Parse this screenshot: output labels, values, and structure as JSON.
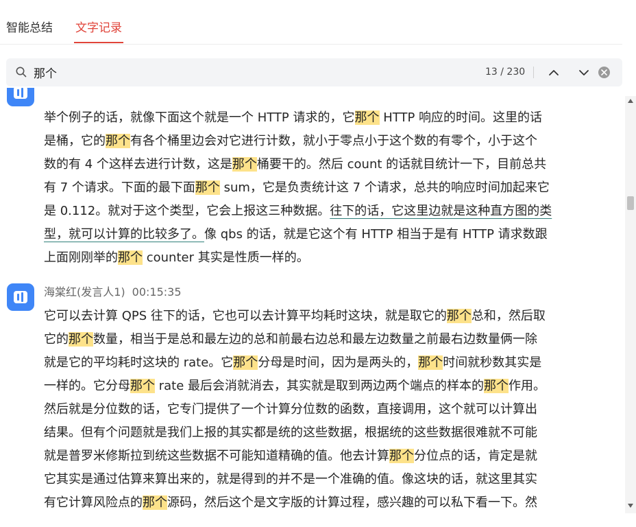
{
  "tabs": [
    {
      "label": "智能总结",
      "active": false
    },
    {
      "label": "文字记录",
      "active": true
    }
  ],
  "search": {
    "value": "那个",
    "counter": "13 / 230"
  },
  "colors": {
    "accent": "#e0443a",
    "highlight": "#fde28a",
    "avatar": "#3f86f7",
    "underline": "#2f7f7a"
  },
  "icons": {
    "search": "search-icon",
    "prev": "chevron-up-icon",
    "next": "chevron-down-icon",
    "clear": "close-circle-icon",
    "avatar": "speaker-icon"
  },
  "transcript": [
    {
      "speaker": "",
      "time": "",
      "lines": [
        [
          {
            "t": "举个例子的话，就像下面这个就是一个 HTTP 请求的，它"
          },
          {
            "t": "那个",
            "hl": true
          },
          {
            "t": " HTTP 响应的时间。这里的话"
          }
        ],
        [
          {
            "t": "是桶，它的"
          },
          {
            "t": "那个",
            "hl": true
          },
          {
            "t": "有各个桶里边会对它进行计数，就小于零点小于这个数的有零个，小于这个"
          }
        ],
        [
          {
            "t": "数的有 4 个这样去进行计数，这是"
          },
          {
            "t": "那个",
            "hl": true
          },
          {
            "t": "桶要干的。然后 count 的话就目统计一下，目前总共"
          }
        ],
        [
          {
            "t": "有 7 个请求。下面的最下面"
          },
          {
            "t": "那个",
            "hl": true
          },
          {
            "t": " sum，它是负责统计这 7 个请求，总共的响应时间加起来它"
          }
        ],
        [
          {
            "t": "是 0.112。就对于这个类型，它会上报这三种数据。"
          },
          {
            "t": "往下的话，它这里边就是这种直方图的类",
            "ul": true
          }
        ],
        [
          {
            "t": "型，就可以计算的比较多了。",
            "ul": true
          },
          {
            "t": "像 qbs 的话，就是它这个有 HTTP 相当于是有 HTTP 请求数跟"
          }
        ],
        [
          {
            "t": "上面刚刚举的"
          },
          {
            "t": "那个",
            "hl": true
          },
          {
            "t": " counter 其实是性质一样的。"
          }
        ]
      ]
    },
    {
      "speaker": "海棠红(发言人1)",
      "time": "00:15:35",
      "lines": [
        [
          {
            "t": "它可以去计算 QPS 往下的话，它也可以去计算平均耗时这块，就是取它的"
          },
          {
            "t": "那个",
            "hl": true
          },
          {
            "t": "总和，然后取"
          }
        ],
        [
          {
            "t": "它的"
          },
          {
            "t": "那个",
            "hl": true
          },
          {
            "t": "数量，相当于是总和最左边的总和前最右边总和最左边数量之前最右边数量俩一除"
          }
        ],
        [
          {
            "t": "就是它的平均耗时这块的 rate。它"
          },
          {
            "t": "那个",
            "hl": true
          },
          {
            "t": "分母是时间，因为是两头的，"
          },
          {
            "t": "那个",
            "hl": true
          },
          {
            "t": "时间就秒数其实是"
          }
        ],
        [
          {
            "t": "一样的。它分母"
          },
          {
            "t": "那个",
            "hl": true
          },
          {
            "t": " rate 最后会消就消去，其实就是取到两边两个端点的样本的"
          },
          {
            "t": "那个",
            "hl": true
          },
          {
            "t": "作用。"
          }
        ],
        [
          {
            "t": "然后就是分位数的话，它专门提供了一个计算分位数的函数，直接调用，这个就可以计算出"
          }
        ],
        [
          {
            "t": "结果。但有个问题就是我们上报的其实都是统的这些数据，根据统的这些数据很难就不可能"
          }
        ],
        [
          {
            "t": "就是普罗米修斯拉到统这些数据不可能知道精确的值。他去计算"
          },
          {
            "t": "那个",
            "hl": true
          },
          {
            "t": "分位点的话，肯定是就"
          }
        ],
        [
          {
            "t": "它其实是通过估算来算出来的，就是得到的并不是一个准确的值。像这块的话，就这里其实"
          }
        ],
        [
          {
            "t": "有它计算风险点的"
          },
          {
            "t": "那个",
            "hl": true
          },
          {
            "t": "源码，然后这个是文字版的计算过程，感兴趣的可以私下看一下。然"
          }
        ]
      ]
    }
  ]
}
